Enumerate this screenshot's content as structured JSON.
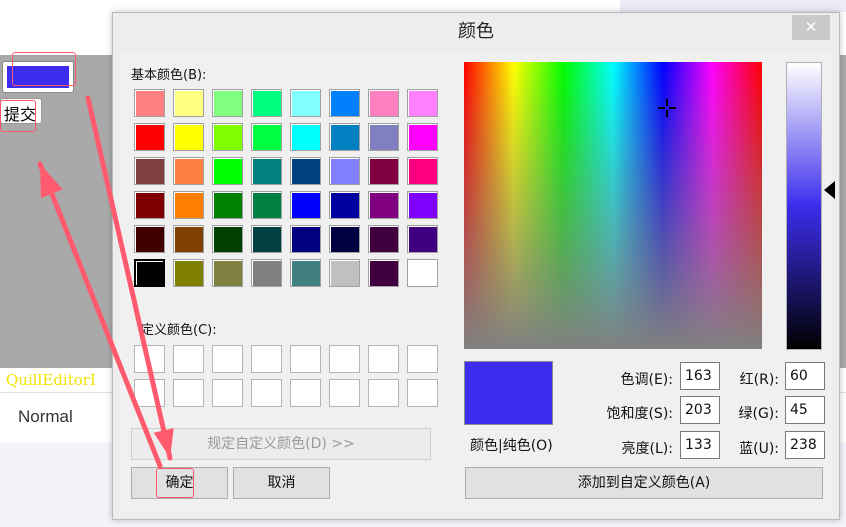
{
  "page": {
    "submit_label": "提交",
    "editor_label": "QuillEditorI",
    "format_select_value": "Normal",
    "current_color": "#3c2dee"
  },
  "dialog": {
    "title": "颜色",
    "close_icon": "close-icon",
    "basic_colors_label": "基本颜色(B):",
    "custom_colors_label": "定义颜色(C):",
    "basic_colors": [
      "#ff8080",
      "#ffff80",
      "#80ff80",
      "#00ff80",
      "#80ffff",
      "#0080ff",
      "#ff80c0",
      "#ff80ff",
      "#ff0000",
      "#ffff00",
      "#80ff00",
      "#00ff40",
      "#00ffff",
      "#0080c0",
      "#8080c0",
      "#ff00ff",
      "#804040",
      "#ff8040",
      "#00ff00",
      "#008080",
      "#004080",
      "#8080ff",
      "#800040",
      "#ff0080",
      "#800000",
      "#ff8000",
      "#008000",
      "#008040",
      "#0000ff",
      "#0000a0",
      "#800080",
      "#8000ff",
      "#400000",
      "#804000",
      "#004000",
      "#004040",
      "#000080",
      "#000040",
      "#400040",
      "#400080",
      "#000000",
      "#808000",
      "#808040",
      "#808080",
      "#408080",
      "#c0c0c0",
      "#400040",
      "#ffffff"
    ],
    "selected_basic_index": 40,
    "define_custom_button": "规定自定义颜色(D) >>",
    "ok_button": "确定",
    "cancel_button": "取消",
    "preview_label": "颜色|纯色(O)",
    "preview_color": "#3c2dee",
    "fields": {
      "hue_label": "色调(E):",
      "hue": "163",
      "sat_label": "饱和度(S):",
      "sat": "203",
      "lum_label": "亮度(L):",
      "lum": "133",
      "red_label": "红(R):",
      "red": "60",
      "green_label": "绿(G):",
      "green": "45",
      "blue_label": "蓝(U):",
      "blue": "238"
    },
    "add_custom_button": "添加到自定义颜色(A)"
  },
  "colors": {
    "highlight": "#ff5a6e",
    "arrow": "#ff5a6e"
  }
}
